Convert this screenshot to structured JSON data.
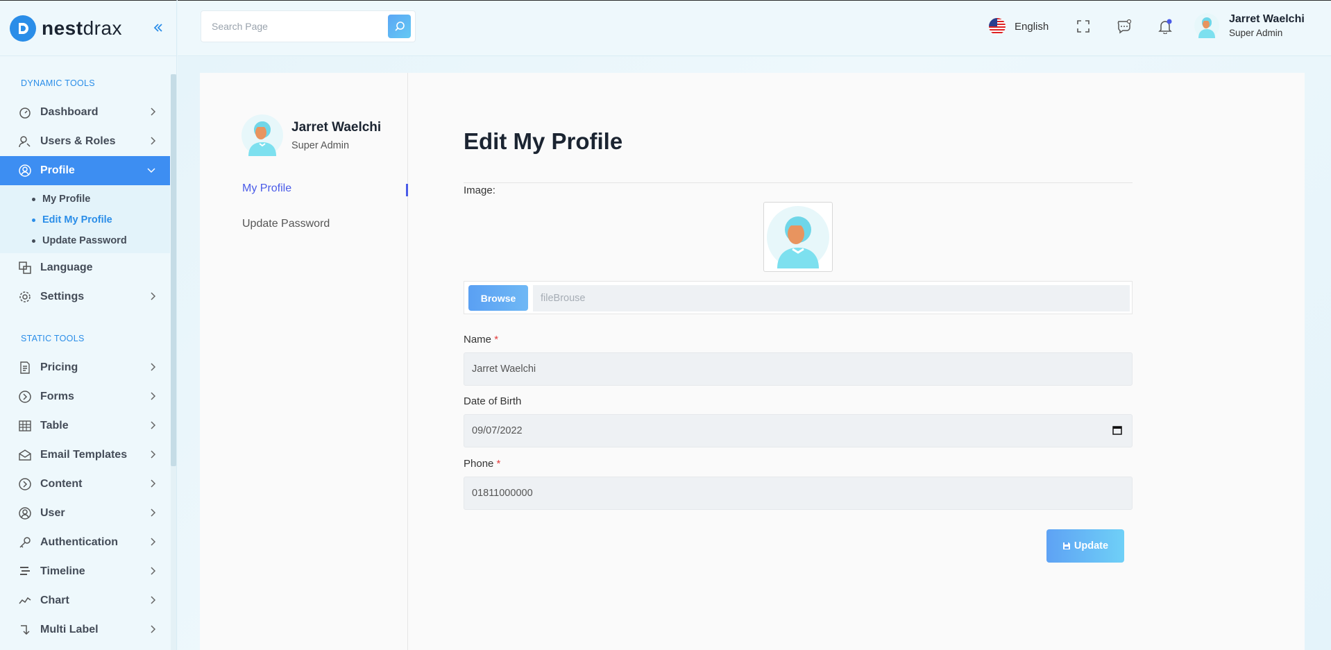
{
  "brand": {
    "name_bold": "nest",
    "name_light": "drax"
  },
  "header": {
    "search_placeholder": "Search Page",
    "language": "English",
    "user_name": "Jarret Waelchi",
    "user_role": "Super Admin"
  },
  "sidebar": {
    "section_dynamic": "DYNAMIC TOOLS",
    "section_static": "STATIC TOOLS",
    "items": {
      "dashboard": "Dashboard",
      "users_roles": "Users & Roles",
      "profile": "Profile",
      "language": "Language",
      "settings": "Settings",
      "pricing": "Pricing",
      "forms": "Forms",
      "table": "Table",
      "email_templates": "Email Templates",
      "content": "Content",
      "user": "User",
      "authentication": "Authentication",
      "timeline": "Timeline",
      "chart": "Chart",
      "multi_label": "Multi Label"
    },
    "profile_sub": {
      "my_profile": "My Profile",
      "edit_my_profile": "Edit My Profile",
      "update_password": "Update Password"
    }
  },
  "profile_pane": {
    "name": "Jarret Waelchi",
    "role": "Super Admin",
    "link_my_profile": "My Profile",
    "link_update_password": "Update Password"
  },
  "form": {
    "title": "Edit My Profile",
    "image_label": "Image:",
    "browse_label": "Browse",
    "file_placeholder": "fileBrouse",
    "name_label": "Name",
    "name_value": "Jarret Waelchi",
    "dob_label": "Date of Birth",
    "dob_value": "09/07/2022",
    "phone_label": "Phone",
    "phone_value": "01811000000",
    "required_mark": "*",
    "update_label": "Update"
  },
  "colors": {
    "accent": "#3d8ef2",
    "active_link": "#4a5be8",
    "required": "#e23b3b"
  }
}
